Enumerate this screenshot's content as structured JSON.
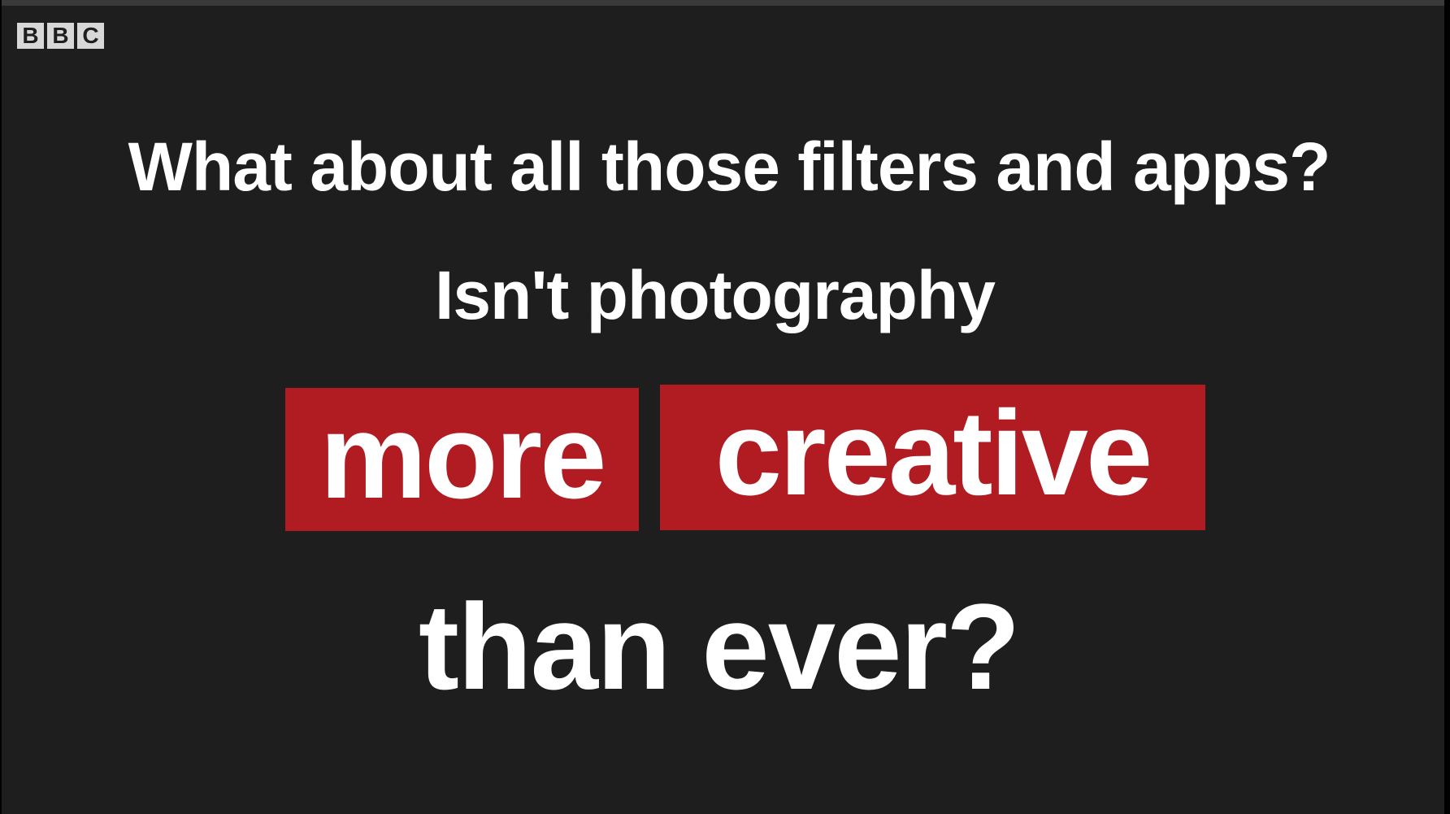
{
  "logo": {
    "letters": [
      "B",
      "B",
      "C"
    ]
  },
  "caption": {
    "line1": "What about all those filters and apps?",
    "line2": "Isn't photography",
    "highlight_words": [
      "more",
      "creative"
    ],
    "line4": "than ever?"
  },
  "colors": {
    "background": "#1e1e1e",
    "text": "#ffffff",
    "highlight": "#b01c22",
    "logo_block": "#d8d8d8"
  }
}
